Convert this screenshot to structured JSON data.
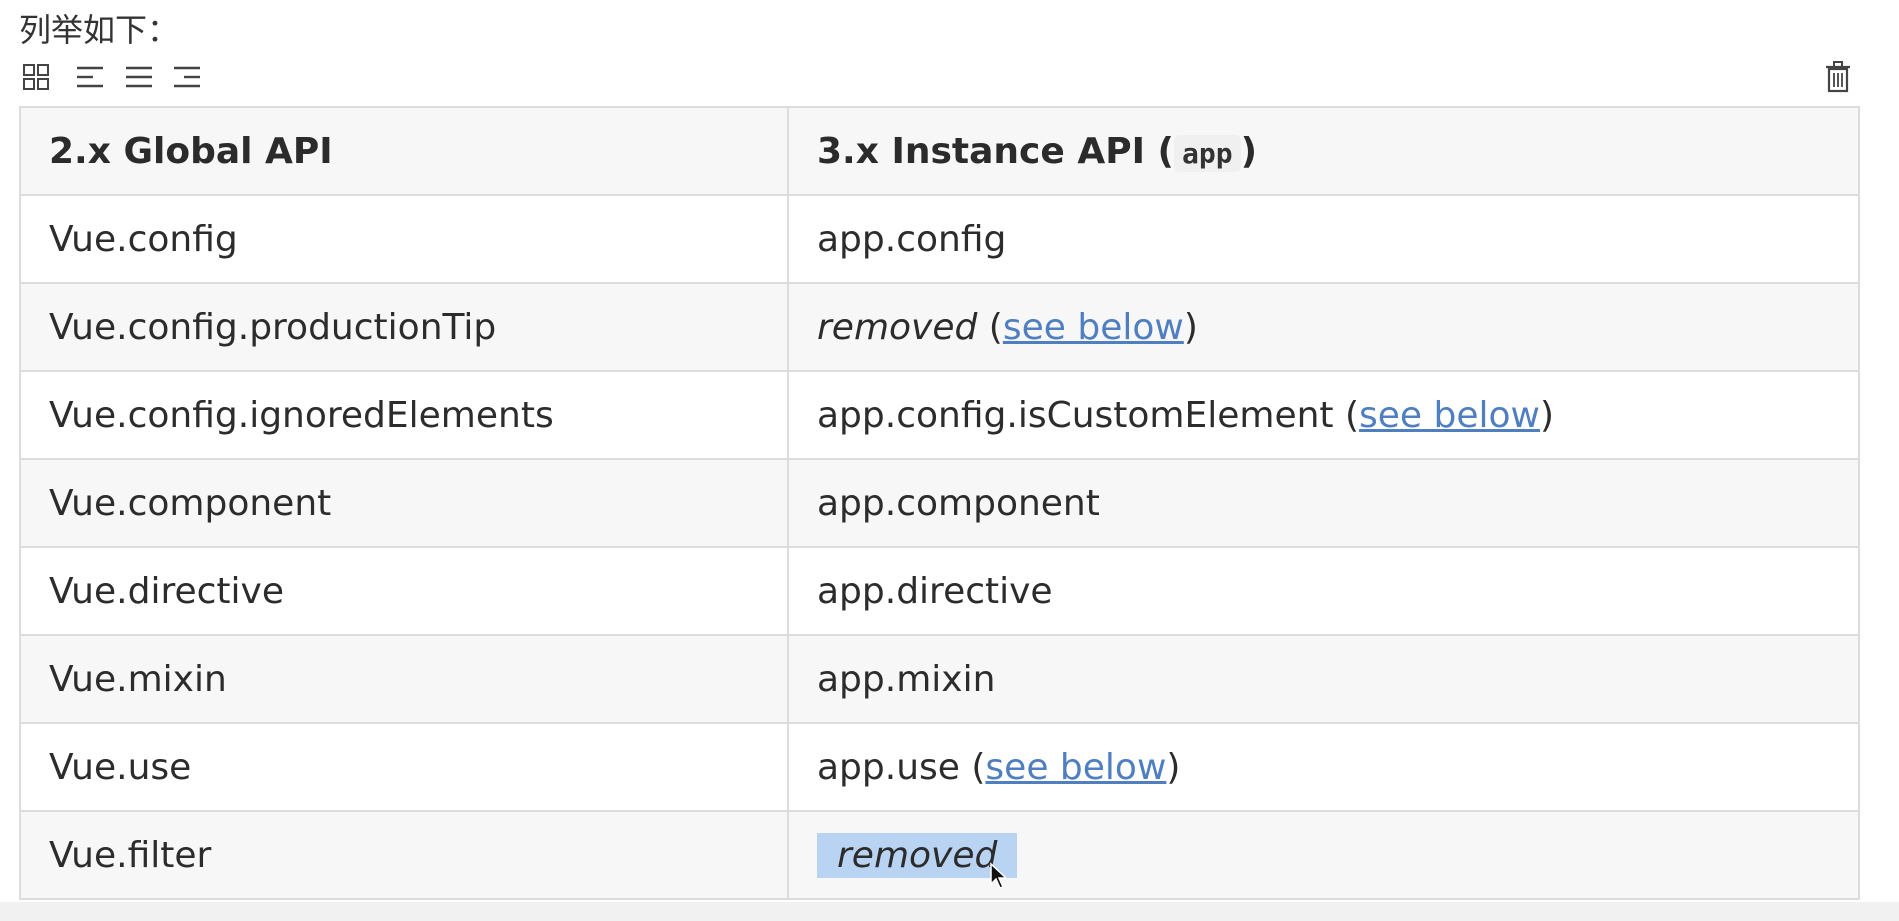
{
  "intro_text": "列举如下：",
  "toolbar": {
    "buttons": [
      {
        "name": "grid-icon"
      },
      {
        "name": "align-left-icon"
      },
      {
        "name": "align-center-icon"
      },
      {
        "name": "align-right-icon"
      },
      {
        "name": "trash-icon"
      }
    ]
  },
  "table": {
    "header": {
      "col1": "2.x Global API",
      "col2_prefix": "3.x Instance API (",
      "col2_code": "app",
      "col2_suffix": ")"
    },
    "rows": [
      {
        "left": "Vue.config",
        "right": "app.config"
      },
      {
        "left": "Vue.config.productionTip",
        "right_em": "removed",
        "right_open": " (",
        "right_link": "see below",
        "right_close": ")"
      },
      {
        "left": "Vue.config.ignoredElements",
        "right": "app.config.isCustomElement (",
        "right_link": "see below",
        "right_close": ")"
      },
      {
        "left": "Vue.component",
        "right": "app.component"
      },
      {
        "left": "Vue.directive",
        "right": "app.directive"
      },
      {
        "left": "Vue.mixin",
        "right": "app.mixin"
      },
      {
        "left": "Vue.use",
        "right": "app.use (",
        "right_link": "see below",
        "right_close": ")"
      },
      {
        "left": "Vue.filter",
        "right_em": "removed"
      }
    ]
  },
  "colors": {
    "link": "#4f7fc1",
    "selection": "#b9d4f3",
    "border": "#dcdcdc",
    "row_shade": "#f7f7f7"
  }
}
